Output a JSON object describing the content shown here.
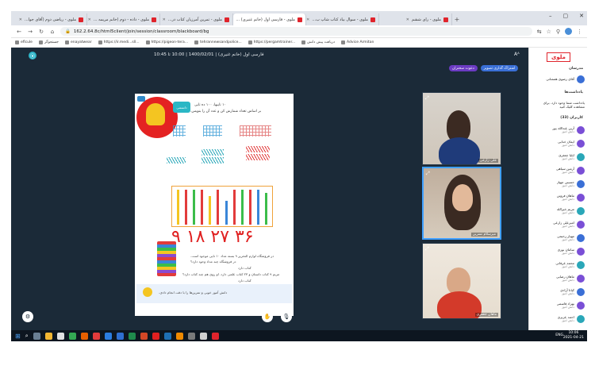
{
  "browser": {
    "tabs": [
      {
        "label": "ملوی - ریاضی دوم (آقای جوا..."
      },
      {
        "label": "ملوی - داده - دوم (خانم مریمه ..."
      },
      {
        "label": "ملوی - تمرین آمرزیان کتاب در..."
      },
      {
        "label": "ملوی - فارسی اول (خانم غنیری) ..."
      },
      {
        "label": "ملوی - سوال بیاد کتاب شاپ ب..."
      },
      {
        "label": "ملوی - رای ششم"
      }
    ],
    "url": "162.2.64.8c/html5client/join/session/classroom/blackboard/bg",
    "bookmarks": [
      "eflcule",
      "جستجوگر",
      "enayatwear",
      "https://ir.medi...sll...",
      "https://pigeon-tera...",
      "tehrannewsandpolice...",
      "https://pergamtrainer...",
      "دریافت پیش دانش",
      "Advice Armitan"
    ]
  },
  "class": {
    "title": "فارسی اول (خانم غنیری) | 1400/02/01 | 10:00 تا 10:45",
    "font_toggle": "A",
    "pill_primary": "اشتراک گذاری تصویر",
    "pill_secondary": "دعوت سخنران"
  },
  "board": {
    "tag": "دانستنی",
    "title": "۱۰ تاییها، ۱۰۰ ده تایی",
    "subtitle": "بر اساس تعداد شمارش کن و عدد آن را بنویس.",
    "handwritten": "۹ ۱۸ ۲۷ ۳۶",
    "question1": "در فروشگاه لوازم التحریر ۹ بسته مداد ۱۰ تایی موجود است.",
    "question1b": "در فروشگاه چند مداد وجود دارد؟",
    "answer1": "کتاب دارد",
    "question2": "مریم ۹ کتاب داستان و ۲۳ کتاب علمی دارد. او روی هم چند کتاب دارد؟",
    "answer2": "کتاب دارد",
    "note": "دانش آموز خوبی و تمرین‌ها را با دقت انجام دادی."
  },
  "videos": [
    {
      "label": "علی زارعی"
    },
    {
      "label": "میرسلام نسرین"
    },
    {
      "label": "ماهان جعفری"
    }
  ],
  "sidebar": {
    "logo": "ملوی",
    "section_teacher": "مدرسان",
    "teacher_name": "آقای رضوی هممتانی",
    "section_notifs": "یادداشت‌ها",
    "notif_text": "یادداشت شما وجود دارد. برای مشاهده کلیک کنید",
    "section_students": "کاربران (33)",
    "students": [
      {
        "name": "آرین عبدالله پور",
        "role": "دانش آموز"
      },
      {
        "name": "ایمان خدایی",
        "role": "دانش آموز"
      },
      {
        "name": "ایلیا جعفری",
        "role": "دانش آموز"
      },
      {
        "name": "آرمین سیاهی",
        "role": "دانش آموز"
      },
      {
        "name": "حسینی مهیار",
        "role": "دانش آموز"
      },
      {
        "name": "ماهان فروتن",
        "role": "دانش آموز"
      },
      {
        "name": "مریم خیرالله",
        "role": "دانش آموز"
      },
      {
        "name": "امیرعلی زارعی",
        "role": "دانش آموز"
      },
      {
        "name": "مهیار رحیمی",
        "role": "دانش آموز"
      },
      {
        "name": "سامان نوری",
        "role": "دانش آموز"
      },
      {
        "name": "محمد عرفانی",
        "role": "دانش آموز"
      },
      {
        "name": "ماهان رضایی",
        "role": "دانش آموز"
      },
      {
        "name": "کیانا آزادی",
        "role": "دانش آموز"
      },
      {
        "name": "بهراد قاسمی",
        "role": "دانش آموز"
      },
      {
        "name": "احمد عزیزی",
        "role": "دانش آموز"
      }
    ]
  },
  "taskbar": {
    "lang": "ENG",
    "time": "10:06",
    "date": "2021-04-21"
  },
  "colors": {
    "app_bg": "#1b2a38",
    "brand": "#e0242c",
    "pill_primary": "#3a6fd6",
    "pill_secondary": "#6b3bc2"
  }
}
